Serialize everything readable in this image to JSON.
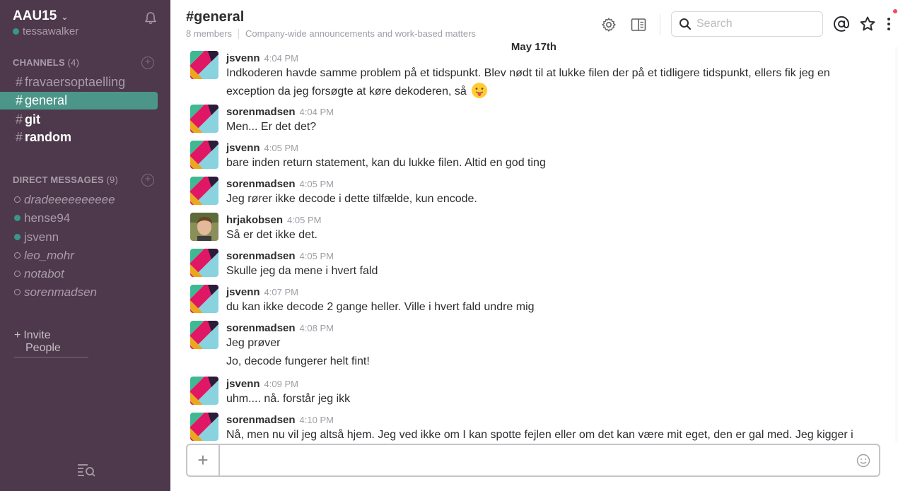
{
  "sidebar": {
    "team_name": "AAU15",
    "team_chevron": "⌄",
    "user": "tessawalker",
    "channels_header": "CHANNELS",
    "channels_count": "(4)",
    "channels": [
      {
        "hash": "#",
        "name": "fravaersoptaelling"
      },
      {
        "hash": "#",
        "name": "general"
      },
      {
        "hash": "#",
        "name": "git"
      },
      {
        "hash": "#",
        "name": "random"
      }
    ],
    "dm_header": "DIRECT MESSAGES",
    "dm_count": "(9)",
    "dms": [
      {
        "name": "dradeeeeeeeeee"
      },
      {
        "name": "hense94"
      },
      {
        "name": "jsvenn"
      },
      {
        "name": "leo_mohr"
      },
      {
        "name": "notabot"
      },
      {
        "name": "sorenmadsen"
      }
    ],
    "invite_plus": "+",
    "invite_line1": "Invite",
    "invite_line2": "People"
  },
  "header": {
    "channel": "#general",
    "members": "8 members",
    "purpose": "Company-wide announcements and work-based matters",
    "search_placeholder": "Search",
    "date": "May 17th"
  },
  "messages": [
    {
      "author": "jsvenn",
      "time": "4:04 PM",
      "text": "Indkoderen havde samme problem på et tidspunkt. Blev nødt til at lukke filen der på et tidligere tidspunkt, ellers fik jeg en exception da jeg forsøgte at køre dekoderen, så"
    },
    {
      "author": "sorenmadsen",
      "time": "4:04 PM",
      "text": "Men... Er det det?"
    },
    {
      "author": "jsvenn",
      "time": "4:05 PM",
      "text": "bare inden return statement, kan du lukke filen. Altid en god ting"
    },
    {
      "author": "sorenmadsen",
      "time": "4:05 PM",
      "text": "Jeg rører ikke decode i dette tilfælde, kun encode."
    },
    {
      "author": "hrjakobsen",
      "time": "4:05 PM",
      "text": "Så er det ikke det."
    },
    {
      "author": "sorenmadsen",
      "time": "4:05 PM",
      "text": "Skulle jeg da mene i hvert fald"
    },
    {
      "author": "jsvenn",
      "time": "4:07 PM",
      "text": "du kan ikke decode 2 gange heller. Ville i hvert fald undre mig"
    },
    {
      "author": "sorenmadsen",
      "time": "4:08 PM",
      "text": "Jeg prøver"
    },
    {
      "text": "Jo, decode fungerer helt fint!"
    },
    {
      "author": "jsvenn",
      "time": "4:09 PM",
      "text": "uhm.... nå. forstår jeg ikk"
    },
    {
      "author": "sorenmadsen",
      "time": "4:10 PM",
      "text": "Nå, men nu vil jeg altså hjem. Jeg ved ikke om I kan spotte fejlen eller om det kan være mit eget, den er gal med. Jeg kigger i"
    }
  ],
  "composer": {
    "plus": "+",
    "placeholder": ""
  },
  "icons": {
    "bell": "bell-icon",
    "settings": "gear-icon",
    "details": "sidebar-panel-icon",
    "search": "search-icon",
    "mentions": "at-icon",
    "star": "star-icon",
    "more": "kebab-menu-icon",
    "emoji": "smiley-icon",
    "filter": "filter-search-icon"
  },
  "colors": {
    "sidebar_bg": "#4d394b",
    "active_channel": "#4c9689",
    "presence_online": "#38978d",
    "notification_dot": "#eb4d5c"
  }
}
